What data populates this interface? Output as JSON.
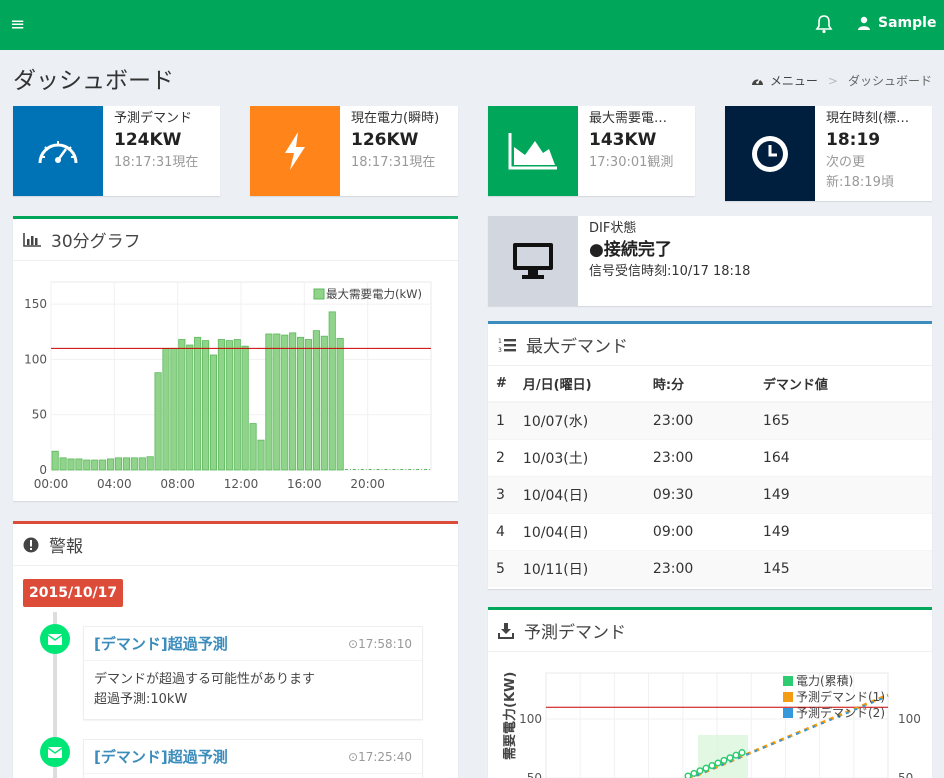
{
  "header": {
    "user_name": "Sample"
  },
  "page": {
    "title": "ダッシュボード",
    "breadcrumb": [
      "メニュー",
      "ダッシュボード"
    ]
  },
  "info_boxes": [
    {
      "label": "予測デマンド",
      "value": "124KW",
      "sub": "18:17:31現在",
      "color": "#0073b7",
      "icon": "speedometer-icon"
    },
    {
      "label": "現在電力(瞬時)",
      "value": "126KW",
      "sub": "18:17:31現在",
      "color": "#ff851b",
      "icon": "lightning-icon"
    },
    {
      "label": "最大需要電…",
      "value": "143KW",
      "sub": "17:30:01観測",
      "color": "#00a65a",
      "icon": "area-chart-icon"
    },
    {
      "label": "現在時刻(標…",
      "value": "18:19",
      "sub": "次の更",
      "sub2": "新:18:19頃",
      "color": "#001f3f",
      "icon": "clock-icon"
    }
  ],
  "graph30": {
    "title": "30分グラフ"
  },
  "chart_data": [
    {
      "type": "bar",
      "title": "30分グラフ",
      "series": [
        {
          "name": "最大需要電力(kW)",
          "color": "#8fd48a",
          "values": [
            17,
            11,
            10,
            10,
            9,
            9,
            9,
            10,
            11,
            11,
            11,
            11,
            12,
            88,
            110,
            110,
            118,
            113,
            120,
            117,
            104,
            118,
            117,
            118,
            112,
            42,
            27,
            123,
            123,
            122,
            124,
            120,
            118,
            126,
            121,
            143,
            119,
            0,
            0,
            0,
            0,
            0,
            0,
            0,
            0,
            0,
            0,
            0
          ]
        }
      ],
      "threshold": 110,
      "ylim": [
        0,
        170
      ],
      "yticks": [
        0,
        50,
        100,
        150
      ],
      "xticks": [
        "00:00",
        "04:00",
        "08:00",
        "12:00",
        "16:00",
        "20:00"
      ]
    },
    {
      "type": "scatter",
      "title": "予測デマンド",
      "ylabel": "需要電力(KW)",
      "yticks": [
        50,
        100
      ],
      "series": [
        {
          "name": "電力(累積)",
          "color": "#2ecc71"
        },
        {
          "name": "予測デマンド(1)",
          "color": "#f39c12"
        },
        {
          "name": "予測デマンド(2)",
          "color": "#3498db"
        }
      ],
      "threshold": 110
    }
  ],
  "dif": {
    "title": "DIF状態",
    "status": "●接続完了",
    "detail": "信号受信時刻:10/17 18:18"
  },
  "maxdemand": {
    "title": "最大デマンド",
    "headers": [
      "#",
      "月/日(曜日)",
      "時:分",
      "デマンド値"
    ],
    "rows": [
      [
        "1",
        "10/07(水)",
        "23:00",
        "165"
      ],
      [
        "2",
        "10/03(土)",
        "23:00",
        "164"
      ],
      [
        "3",
        "10/04(日)",
        "09:30",
        "149"
      ],
      [
        "4",
        "10/04(日)",
        "09:00",
        "149"
      ],
      [
        "5",
        "10/11(日)",
        "23:00",
        "145"
      ]
    ]
  },
  "alerts": {
    "title": "警報",
    "date": "2015/10/17",
    "items": [
      {
        "title": "[デマンド]超過予測",
        "time": "17:58:10",
        "line1": "デマンドが超過する可能性があります",
        "line2": "超過予測:10kW"
      },
      {
        "title": "[デマンド]超過予測",
        "time": "17:25:40"
      }
    ]
  },
  "forecast": {
    "title": "予測デマンド"
  }
}
